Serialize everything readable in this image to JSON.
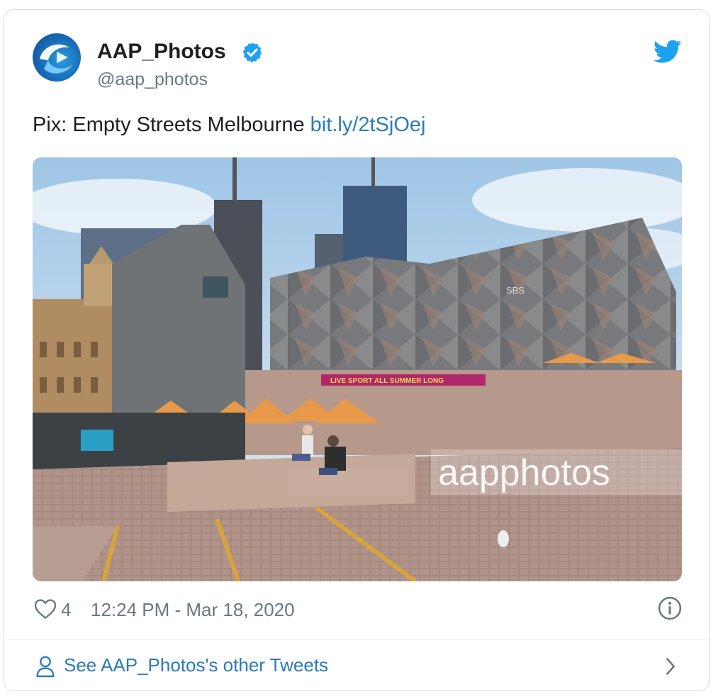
{
  "user": {
    "display_name": "AAP_Photos",
    "handle": "@aap_photos",
    "verified_icon": "verified-badge-icon",
    "avatar_icon": "aap-logo-avatar"
  },
  "tweet": {
    "text": "Pix: Empty Streets Melbourne",
    "link": "bit.ly/2tSjOej"
  },
  "photo": {
    "banner_text": "LIVE SPORT ALL SUMMER LONG",
    "building_logo": "SBS",
    "watermark": "aapphotos"
  },
  "footer": {
    "like_count": "4",
    "timestamp": "12:24 PM - Mar 18, 2020"
  },
  "more_tweets": {
    "label": "See AAP_Photos's other Tweets"
  },
  "colors": {
    "link": "#2b7bb9",
    "twitter_blue": "#1da1f2",
    "muted_text": "#697882",
    "border": "#d9dee3"
  }
}
